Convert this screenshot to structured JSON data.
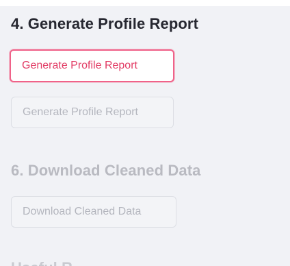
{
  "sections": {
    "generate": {
      "title": "4. Generate Profile Report",
      "button_label": "Generate Profile Report"
    },
    "disabled_generate": {
      "button_label": "Generate Profile Report"
    },
    "download": {
      "title": "6. Download Cleaned Data",
      "button_label": "Download Cleaned Data"
    },
    "useful": {
      "title": "Useful R..."
    }
  },
  "colors": {
    "panel_bg": "#f1f2f6",
    "accent": "#e23c65",
    "accent_border": "#f06289",
    "disabled_text": "#b4b6be",
    "heading_text": "#262730"
  }
}
